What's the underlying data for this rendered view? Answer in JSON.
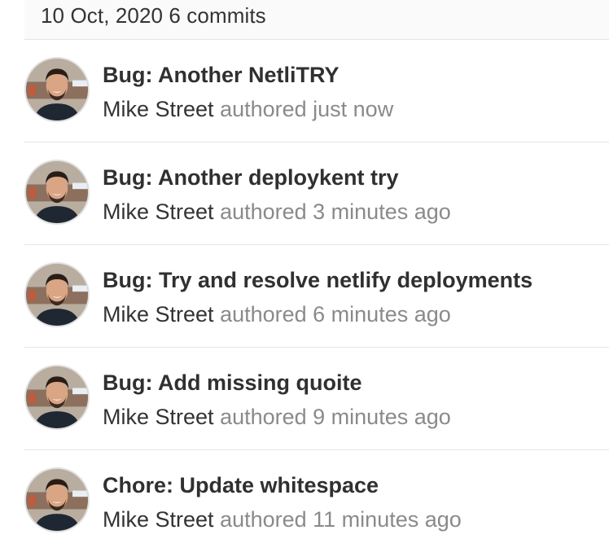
{
  "header": {
    "date": "10 Oct, 2020",
    "count": "6 commits"
  },
  "commits": [
    {
      "title": "Bug: Another NetliTRY",
      "author": "Mike Street",
      "time": "authored just now"
    },
    {
      "title": "Bug: Another deploykent try",
      "author": "Mike Street",
      "time": "authored 3 minutes ago"
    },
    {
      "title": "Bug: Try and resolve netlify deployments",
      "author": "Mike Street",
      "time": "authored 6 minutes ago"
    },
    {
      "title": "Bug: Add missing quoite",
      "author": "Mike Street",
      "time": "authored 9 minutes ago"
    },
    {
      "title": "Chore: Update whitespace",
      "author": "Mike Street",
      "time": "authored 11 minutes ago"
    }
  ],
  "colors": {
    "title": "#303030",
    "author": "#333333",
    "muted": "#8a8a8a",
    "divider": "#e5e5e5",
    "header_bg": "#fafafa"
  }
}
